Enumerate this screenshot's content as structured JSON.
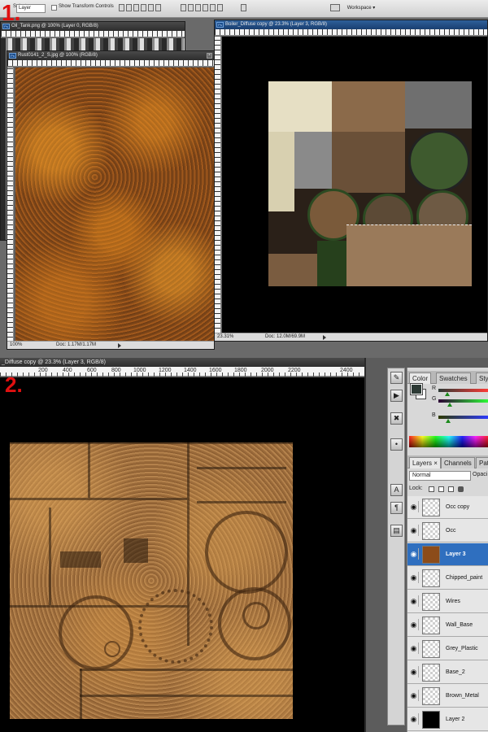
{
  "step_markers": {
    "first": "1.",
    "second": "2."
  },
  "part1": {
    "options_bar": {
      "select_prefix": "Select:",
      "select_value": "Layer",
      "show_transform_label": "Show Transform Controls",
      "workspace_label": "Workspace ▾"
    },
    "windows": {
      "oil_tank": {
        "title": "Oil_Tank.png @ 100% (Layer 0, RGB/8)"
      },
      "rust": {
        "title": "Rust0141_2_S.jpg @ 100% (RGB/8)",
        "zoom": "100%",
        "doc": "Doc: 1.17M/1.17M"
      },
      "boiler": {
        "title": "Boiler_Diffuse copy @ 23.3% (Layer 3, RGB/8)",
        "zoom": "23.31%",
        "doc": "Doc: 12.0M/69.9M"
      }
    }
  },
  "part2": {
    "document_title": "_Diffuse copy @ 23.3% (Layer 3, RGB/8)",
    "ruler_ticks": [
      "200",
      "400",
      "600",
      "800",
      "1000",
      "1200",
      "1400",
      "1600",
      "1800",
      "2000",
      "2200",
      "2400"
    ],
    "color_panel": {
      "tabs": [
        "Color",
        "Swatches",
        "Styl"
      ],
      "channels": [
        "R",
        "G",
        "B"
      ],
      "channel_levels": [
        0.18,
        0.22,
        0.2
      ],
      "foreground_color": "#2d3a35",
      "background_color": "#ffffff"
    },
    "layers_panel": {
      "tabs": [
        "Layers ×",
        "Channels",
        "Pat"
      ],
      "blend_mode": "Normal",
      "opacity_label": "Opaci",
      "lock_label": "Lock:",
      "layers": [
        {
          "name": "Occ copy",
          "selected": false
        },
        {
          "name": "Occ",
          "selected": false
        },
        {
          "name": "Layer 3",
          "selected": true
        },
        {
          "name": "Chipped_paint",
          "selected": false
        },
        {
          "name": "Wires",
          "selected": false
        },
        {
          "name": "Wall_Base",
          "selected": false
        },
        {
          "name": "Grey_Plastic",
          "selected": false
        },
        {
          "name": "Base_2",
          "selected": false
        },
        {
          "name": "Brown_Metal",
          "selected": false
        },
        {
          "name": "Layer 2",
          "selected": false
        }
      ]
    },
    "tool_icons": [
      "brush-icon",
      "play-icon",
      "tools-icon",
      "stamp-icon",
      "type-icon",
      "paragraph-icon",
      "layers-comp-icon"
    ],
    "tool_glyphs": [
      "✎",
      "▶",
      "✖",
      "•",
      "A",
      "¶",
      "▤"
    ]
  },
  "colors": {
    "accent_selected": "#2f6fbf",
    "step_marker_red": "#e01010",
    "rust_orange": "#8c4c1a"
  }
}
